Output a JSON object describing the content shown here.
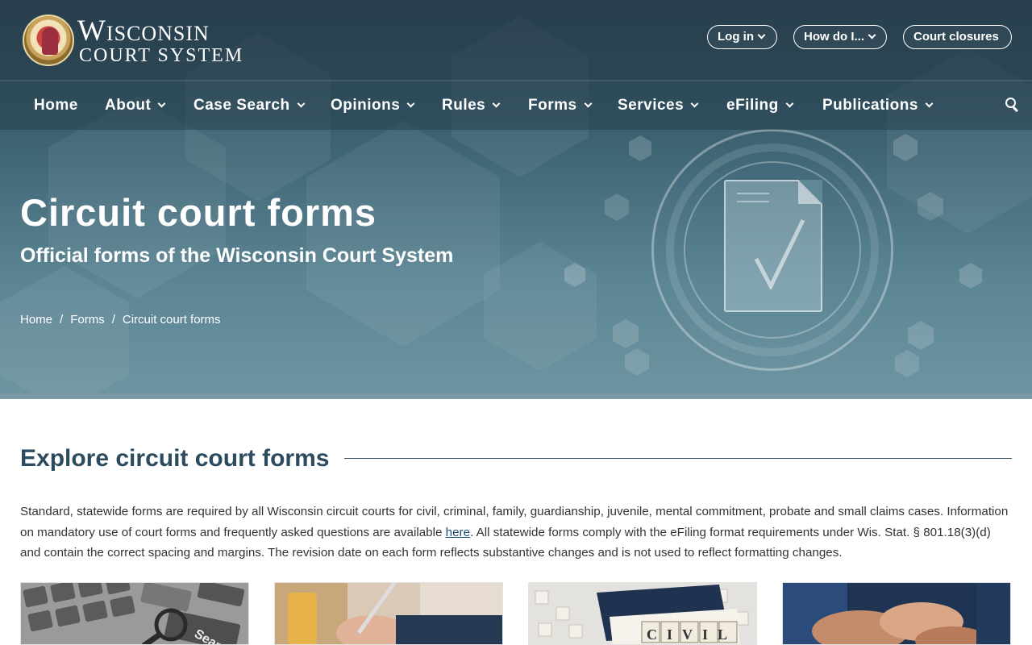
{
  "header": {
    "logo_line1": "Wisconsin",
    "logo_line2": "Court System",
    "utility_links": [
      {
        "label": "Log in",
        "has_dropdown": true
      },
      {
        "label": "How do I...",
        "has_dropdown": true
      },
      {
        "label": "Court closures",
        "has_dropdown": false
      }
    ]
  },
  "nav": {
    "items": [
      {
        "label": "Home",
        "has_dropdown": false
      },
      {
        "label": "About",
        "has_dropdown": true
      },
      {
        "label": "Case Search",
        "has_dropdown": true
      },
      {
        "label": "Opinions",
        "has_dropdown": true
      },
      {
        "label": "Rules",
        "has_dropdown": true
      },
      {
        "label": "Forms",
        "has_dropdown": true
      },
      {
        "label": "Services",
        "has_dropdown": true
      },
      {
        "label": "eFiling",
        "has_dropdown": true
      },
      {
        "label": "Publications",
        "has_dropdown": true
      }
    ],
    "search_icon": "search-icon"
  },
  "hero": {
    "title": "Circuit court forms",
    "subtitle": "Official forms of the Wisconsin Court System",
    "breadcrumb": [
      "Home",
      "Forms",
      "Circuit court forms"
    ],
    "separator": "/"
  },
  "main": {
    "section_title": "Explore circuit court forms",
    "intro_part1": "Standard, statewide forms are required by all Wisconsin circuit courts for civil, criminal, family, guardianship, juvenile, mental commitment, probate and small claims cases. Information on mandatory use of court forms and frequently asked questions are available ",
    "intro_link": "here",
    "intro_part2": ". All statewide forms comply with the eFiling format requirements under Wis. Stat. § 801.18(3)(d) and contain the correct spacing and margins. The revision date on each form reflects substantive changes and is not used to reflect formatting changes.",
    "cards": [
      {
        "image_label": "Search",
        "image_desc": "keyboard"
      },
      {
        "image_label": "",
        "image_desc": "writing"
      },
      {
        "image_label": "CIVIL",
        "image_desc": "book-civil"
      },
      {
        "image_label": "",
        "image_desc": "hands"
      }
    ]
  },
  "colors": {
    "header_dark": "#2e4a5a",
    "accent_title": "#2d4b5e",
    "link": "#1b4c6c"
  }
}
